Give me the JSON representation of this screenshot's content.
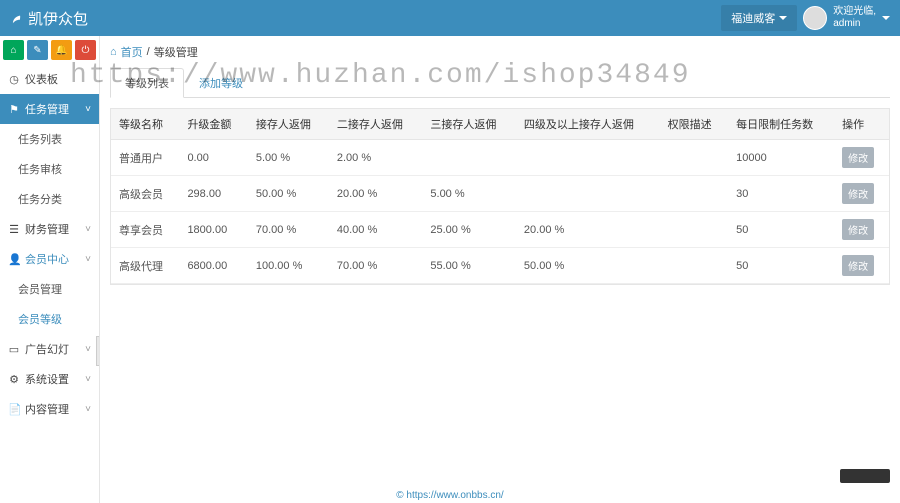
{
  "header": {
    "brand": "凯伊众包",
    "platform_label": "福迪威客",
    "welcome": "欢迎光临,",
    "username": "admin"
  },
  "breadcrumb": {
    "home": "首页",
    "current": "等级管理"
  },
  "sidebar": {
    "dashboard": "仪表板",
    "task_mgmt": "任务管理",
    "task_list": "任务列表",
    "task_audit": "任务审核",
    "task_cat": "任务分类",
    "finance": "财务管理",
    "member": "会员中心",
    "member_mgmt": "会员管理",
    "member_level": "会员等级",
    "ads": "广告幻灯",
    "system": "系统设置",
    "content": "内容管理"
  },
  "tabs": {
    "list": "等级列表",
    "add": "添加等级"
  },
  "table": {
    "headers": [
      "等级名称",
      "升级金额",
      "接存人返佣",
      "二接存人返佣",
      "三接存人返佣",
      "四级及以上接存人返佣",
      "权限描述",
      "每日限制任务数",
      "操作"
    ],
    "rows": [
      {
        "name": "普通用户",
        "amount": "0.00",
        "r1": "5.00 %",
        "r2": "2.00 %",
        "r3": "",
        "r4": "",
        "perm": "",
        "limit": "10000",
        "op": "修改"
      },
      {
        "name": "高级会员",
        "amount": "298.00",
        "r1": "50.00 %",
        "r2": "20.00 %",
        "r3": "5.00 %",
        "r4": "",
        "perm": "",
        "limit": "30",
        "op": "修改"
      },
      {
        "name": "尊享会员",
        "amount": "1800.00",
        "r1": "70.00 %",
        "r2": "40.00 %",
        "r3": "25.00 %",
        "r4": "20.00 %",
        "perm": "",
        "limit": "50",
        "op": "修改"
      },
      {
        "name": "高级代理",
        "amount": "6800.00",
        "r1": "100.00 %",
        "r2": "70.00 %",
        "r3": "55.00 %",
        "r4": "50.00 %",
        "perm": "",
        "limit": "50",
        "op": "修改"
      }
    ]
  },
  "watermark": "https://www.huzhan.com/ishop34849",
  "footer": "© https://www.onbbs.cn/"
}
